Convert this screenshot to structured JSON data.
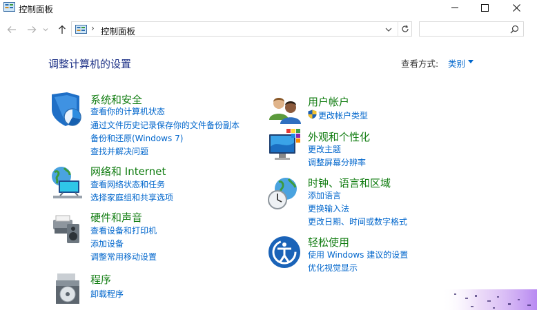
{
  "window": {
    "title": "控制面板"
  },
  "address": {
    "crumb": "控制面板",
    "separator": "›"
  },
  "main": {
    "heading": "调整计算机的设置",
    "view_by_label": "查看方式:",
    "view_by_value": "类别"
  },
  "categories": [
    {
      "title": "系统和安全",
      "links": [
        "查看你的计算机状态",
        "通过文件历史记录保存你的文件备份副本",
        "备份和还原(Windows 7)",
        "查找并解决问题"
      ]
    },
    {
      "title": "网络和 Internet",
      "links": [
        "查看网络状态和任务",
        "选择家庭组和共享选项"
      ]
    },
    {
      "title": "硬件和声音",
      "links": [
        "查看设备和打印机",
        "添加设备",
        "调整常用移动设置"
      ]
    },
    {
      "title": "程序",
      "links": [
        "卸载程序"
      ]
    },
    {
      "title": "用户帐户",
      "links": [
        "更改帐户类型"
      ]
    },
    {
      "title": "外观和个性化",
      "links": [
        "更改主题",
        "调整屏幕分辨率"
      ]
    },
    {
      "title": "时钟、语言和区域",
      "links": [
        "添加语言",
        "更换输入法",
        "更改日期、时间或数字格式"
      ]
    },
    {
      "title": "轻松使用",
      "links": [
        "使用 Windows 建议的设置",
        "优化视觉显示"
      ]
    }
  ],
  "colors": {
    "heading": "#1e3287",
    "category_title": "#107c10",
    "link": "#0066cc"
  },
  "icons": {
    "titlebar": "control-panel-icon",
    "minimize": "minimize-icon",
    "maximize": "maximize-icon",
    "close": "close-icon",
    "back": "back-arrow-icon",
    "forward": "forward-arrow-icon",
    "recent": "chevron-down-icon",
    "up": "up-arrow-icon",
    "refresh": "refresh-icon",
    "search": "search-icon"
  }
}
